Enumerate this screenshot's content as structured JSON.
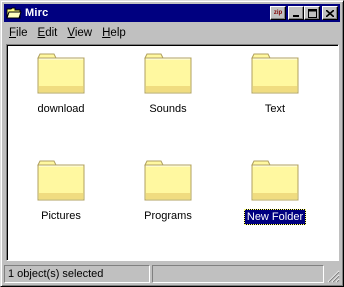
{
  "window": {
    "title": "Mirc",
    "title_icon": "folder-open-icon",
    "buttons": {
      "zip": "zip",
      "minimize": "_",
      "maximize": "□",
      "close": "✕"
    }
  },
  "menu": {
    "items": [
      {
        "label": "File",
        "accel": "F",
        "rest": "ile"
      },
      {
        "label": "Edit",
        "accel": "E",
        "rest": "dit"
      },
      {
        "label": "View",
        "accel": "V",
        "rest": "iew"
      },
      {
        "label": "Help",
        "accel": "H",
        "rest": "elp"
      }
    ]
  },
  "folders": [
    {
      "label": "download",
      "icon": "folder-icon"
    },
    {
      "label": "Sounds",
      "icon": "folder-icon"
    },
    {
      "label": "Text",
      "icon": "folder-icon"
    },
    {
      "label": "Pictures",
      "icon": "folder-icon"
    },
    {
      "label": "Programs",
      "icon": "folder-icon"
    },
    {
      "label": "New Folder",
      "icon": "folder-icon",
      "selected": true
    }
  ],
  "status": {
    "main": "1 object(s) selected",
    "second": ""
  },
  "colors": {
    "titlebar": "#000080",
    "face": "#c0c0c0",
    "folder_fill": "#ffff99",
    "folder_shade": "#e0c860"
  }
}
